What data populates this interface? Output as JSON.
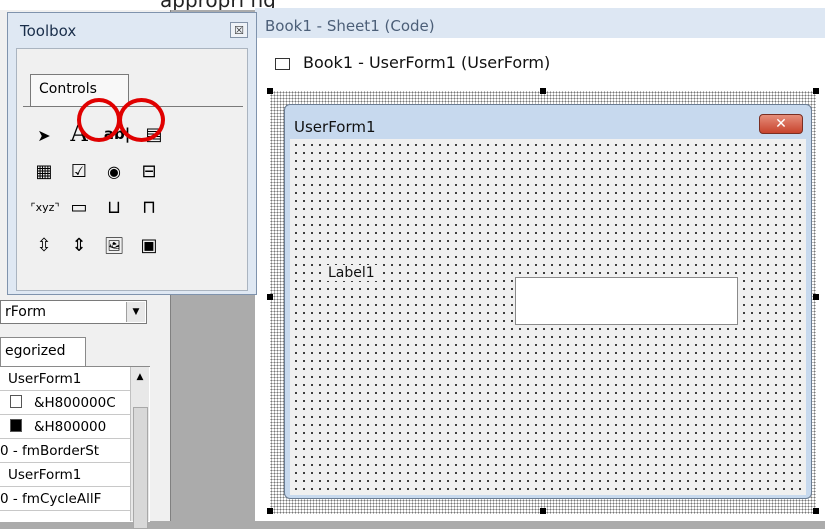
{
  "top_fragment": {
    "text": "appropri                                                             ng"
  },
  "code_window": {
    "title": "Book1 - Sheet1 (Code)"
  },
  "designer_window": {
    "title": "Book1 - UserForm1 (UserForm)"
  },
  "userform": {
    "caption": "UserForm1",
    "close_glyph": "✕",
    "label_text": "Label1",
    "textbox_value": ""
  },
  "toolbox": {
    "title": "Toolbox",
    "close_glyph": "☒",
    "tab_label": "Controls",
    "highlighted_tools": [
      "label-tool",
      "textbox-tool"
    ],
    "highlight_color": "#e00000",
    "tools": [
      {
        "name": "select-objects-tool",
        "glyph": "➤"
      },
      {
        "name": "label-tool",
        "glyph": "A"
      },
      {
        "name": "textbox-tool",
        "glyph": "ab|"
      },
      {
        "name": "combobox-tool",
        "glyph": "▤"
      },
      {
        "name": "listbox-tool",
        "glyph": "▦"
      },
      {
        "name": "checkbox-tool",
        "glyph": "☑"
      },
      {
        "name": "optionbutton-tool",
        "glyph": "◉"
      },
      {
        "name": "togglebutton-tool",
        "glyph": "⊟"
      },
      {
        "name": "frame-tool",
        "glyph": "⌜xyz⌝"
      },
      {
        "name": "commandbutton-tool",
        "glyph": "▭"
      },
      {
        "name": "tabstrip-tool",
        "glyph": "⊔"
      },
      {
        "name": "multipage-tool",
        "glyph": "⊓"
      },
      {
        "name": "scrollbar-tool",
        "glyph": "⇳"
      },
      {
        "name": "spinbutton-tool",
        "glyph": "⇕"
      },
      {
        "name": "image-tool",
        "glyph": "🖼"
      },
      {
        "name": "refedit-tool",
        "glyph": "▣"
      }
    ]
  },
  "properties": {
    "object_combo_value": "rForm",
    "tab_label": "egorized",
    "rows": [
      {
        "value": "UserForm1"
      },
      {
        "value": "&H800000C",
        "swatch": "#ffffff"
      },
      {
        "value": "&H800000",
        "swatch": "#000000"
      },
      {
        "value": "0 - fmBorderSt"
      },
      {
        "value": "UserForm1"
      },
      {
        "value": "0 - fmCycleAllF"
      }
    ]
  }
}
